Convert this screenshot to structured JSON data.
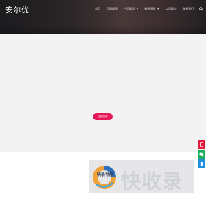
{
  "site": {
    "title": "安尔优"
  },
  "nav": {
    "items": [
      {
        "label": "首页"
      },
      {
        "label": "品牌展示"
      },
      {
        "label": "产品展示",
        "dropdown": true
      },
      {
        "label": "新闻资讯",
        "dropdown": true
      },
      {
        "label": "公司简介"
      },
      {
        "label": "联系我们"
      }
    ]
  },
  "hero": {
    "cta_label": "立即咨询"
  },
  "side_buttons": [
    "phone-icon",
    "wechat-icon",
    "qq-icon"
  ],
  "watermark": {
    "text": "快收录",
    "subtext": "快录导航"
  },
  "colors": {
    "accent": "#e6185a",
    "phone": "#e01d3d",
    "wechat": "#1aad5b",
    "qq": "#1f8fe0",
    "content_bg": "#f3f3f3"
  }
}
